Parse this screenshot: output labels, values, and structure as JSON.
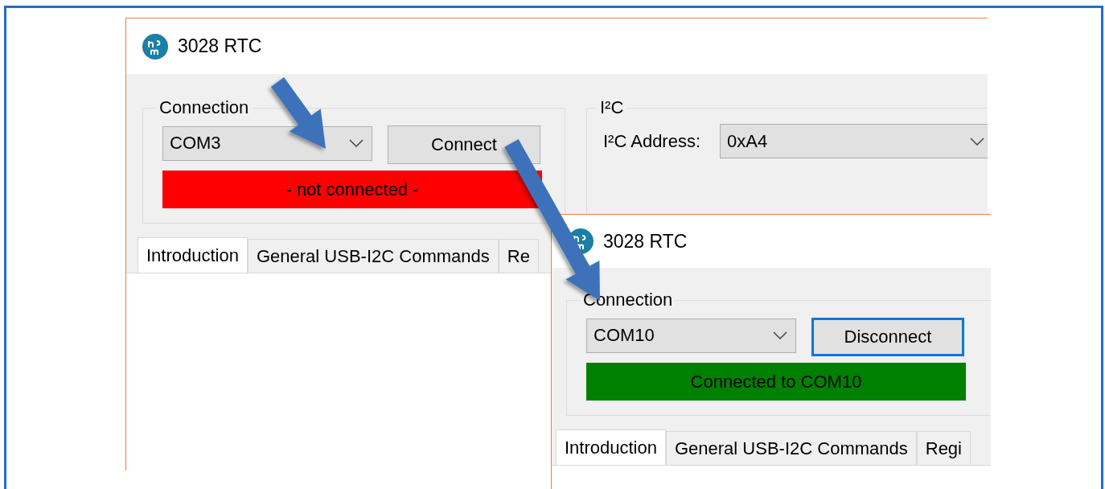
{
  "windows": [
    {
      "title": "3028 RTC",
      "connection": {
        "label": "Connection",
        "port": "COM3",
        "button": "Connect",
        "button_focused": false,
        "status": "- not connected -",
        "connected": false
      },
      "i2c": {
        "label": "I²C",
        "address_label": "I²C Address:",
        "address": "0xA4"
      },
      "tabs": [
        {
          "label": "Introduction",
          "selected": true
        },
        {
          "label": "General USB-I2C Commands",
          "selected": false
        },
        {
          "label": "Re",
          "selected": false
        }
      ]
    },
    {
      "title": "3028 RTC",
      "connection": {
        "label": "Connection",
        "port": "COM10",
        "button": "Disconnect",
        "button_focused": true,
        "status": "Connected to COM10",
        "connected": true
      },
      "tabs": [
        {
          "label": "Introduction",
          "selected": true
        },
        {
          "label": "General USB-I2C Commands",
          "selected": false
        },
        {
          "label": "Regi",
          "selected": false
        }
      ]
    }
  ]
}
